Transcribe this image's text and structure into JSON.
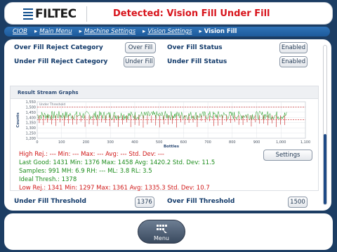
{
  "header": {
    "logo_text": "FILTEC",
    "title": "Detected: Vision Fill Under Fill"
  },
  "breadcrumbs": [
    "CIOB",
    "Main Menu",
    "Machine Settings",
    "Vision Settings",
    "Vision Fill"
  ],
  "settings": {
    "over_fill_reject_category": {
      "label": "Over Fill Reject Category",
      "value": "Over Fill"
    },
    "over_fill_status": {
      "label": "Over Fill Status",
      "value": "Enabled"
    },
    "under_fill_reject_category": {
      "label": "Under Fill Reject Category",
      "value": "Under Fill"
    },
    "under_fill_status": {
      "label": "Under Fill Status",
      "value": "Enabled"
    }
  },
  "graph": {
    "section_title": "Result Stream Graphs",
    "settings_label": "Settings"
  },
  "chart_data": {
    "type": "line",
    "title": "",
    "legend": [
      "Under Threshold"
    ],
    "xlabel": "Bottles",
    "ylabel": "Counts",
    "xlim": [
      0,
      1100
    ],
    "ylim": [
      1200,
      1550
    ],
    "x_ticks": [
      "0",
      "100",
      "200",
      "300",
      "400",
      "500",
      "600",
      "700",
      "800",
      "900",
      "1,000",
      "1,100"
    ],
    "y_ticks": [
      "1,550",
      "1,500",
      "1,450",
      "1,400",
      "1,350",
      "1,300",
      "1,250",
      "1,200"
    ],
    "series": [
      {
        "name": "Good",
        "color": "#1f9a1f",
        "mean": 1420,
        "range": [
          1376,
          1458
        ],
        "count": 1431
      },
      {
        "name": "Rejected",
        "color": "#c81a1a",
        "mean": 1335,
        "range": [
          1297,
          1361
        ],
        "count": 1341
      }
    ],
    "reference_lines": [
      1378,
      1500
    ],
    "grid": true
  },
  "stats": {
    "high_rej": "High Rej.:  ---  Min:  ---  Max:  ---  Avg:  ---  Std. Dev:  ---",
    "last_good": "Last Good:  1431     Min:  1376  Max:  1458  Avg:  1420.2  Std. Dev:  11.5",
    "samples": "Samples:  991        MH:  6.9    RH:  ---        ML:  3.8        RL:  3.5",
    "ideal": "Ideal Thresh.:  1378",
    "low_rej": "Low Rej.:  1341  Min:  1297  Max:  1361  Avg:  1335.3  Std. Dev:  10.7"
  },
  "thresholds": {
    "under": {
      "label": "Under Fill Threshold",
      "value": "1376"
    },
    "over": {
      "label": "Over Fill Threshold",
      "value": "1500"
    }
  },
  "footer": {
    "menu_label": "Menu"
  },
  "colors": {
    "accent": "#1d5a9a",
    "alert": "#d8141c",
    "good": "#1b8c1b"
  }
}
